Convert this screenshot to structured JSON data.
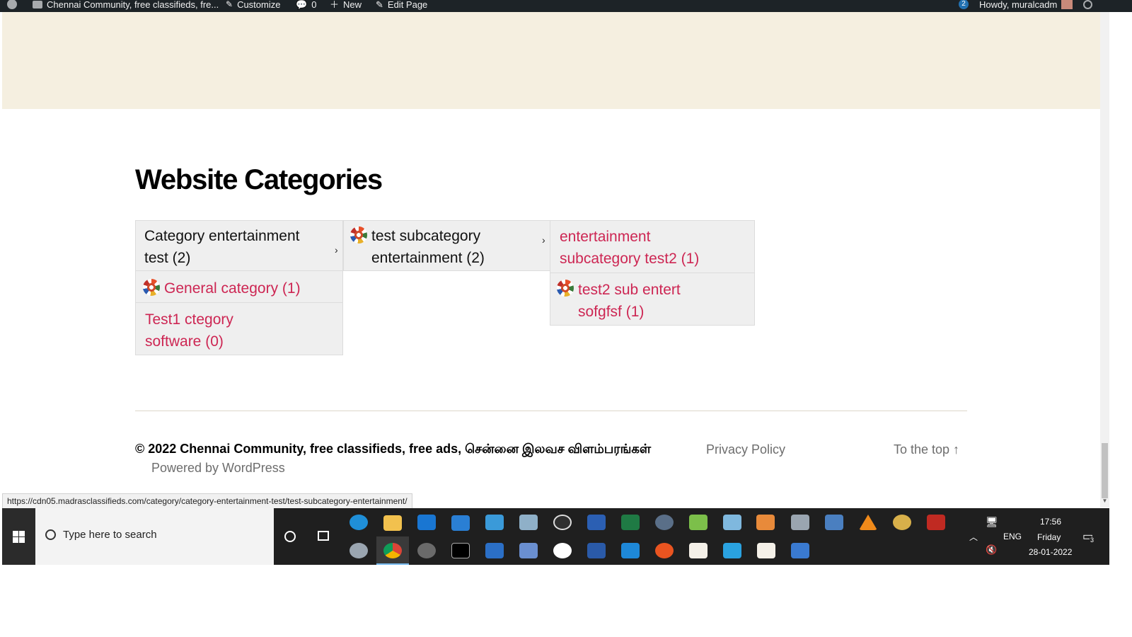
{
  "admin_bar": {
    "site_name": "Chennai Community, free classifieds, fre...",
    "customize": "Customize",
    "comments": "0",
    "new": "New",
    "edit_page": "Edit Page",
    "updates_count": "2",
    "howdy": "Howdy, muralcadm"
  },
  "section": {
    "title": "Website Categories"
  },
  "menu": {
    "col1": [
      {
        "label": "Category entertainment test (2)"
      },
      {
        "label": "General category (1)"
      },
      {
        "label": "Test1 ctegory software (0)"
      }
    ],
    "col2": [
      {
        "label": "test subcategory entertainment (2)"
      }
    ],
    "col3": [
      {
        "label": "entertainment subcategory test2 (1)"
      },
      {
        "label": "test2 sub entert sofgfsf (1)"
      }
    ]
  },
  "footer": {
    "copyright": "© 2022 Chennai Community, free classifieds, free ads, சென்னை இலவச விளம்பரங்கள்",
    "privacy": "Privacy Policy",
    "powered": "Powered by WordPress",
    "to_top": "To the top ↑"
  },
  "status_bar": {
    "url": "https://cdn05.madrasclassifieds.com/category/category-entertainment-test/test-subcategory-entertainment/"
  },
  "taskbar": {
    "search_placeholder": "Type here to search",
    "language": "ENG",
    "time": "17:56",
    "day": "Friday",
    "date": "28-01-2022",
    "notification_count": "3"
  },
  "colors": {
    "link": "#cd2653",
    "hero_bg": "#f5efe0",
    "menu_bg": "#efefef",
    "taskbar_bg": "#1f1f1f"
  }
}
